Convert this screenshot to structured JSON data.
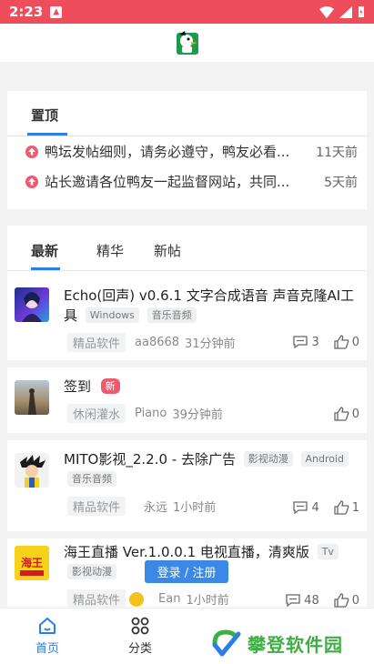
{
  "status_bar": {
    "time": "2:23"
  },
  "pinned": {
    "tab_label": "置顶",
    "items": [
      {
        "title": "鸭坛发帖细则，请务必遵守，鸭友必看...",
        "time": "11天前"
      },
      {
        "title": "站长邀请各位鸭友一起监督网站，共同...",
        "time": "5天前"
      }
    ]
  },
  "feed": {
    "tabs": [
      "最新",
      "精华",
      "新帖"
    ],
    "posts": [
      {
        "title": "Echo(回声) v0.6.1 文字合成语音 声音克隆AI工具",
        "tags": [
          "Windows",
          "音乐音频"
        ],
        "category": "精品软件",
        "author": "aa8668",
        "time": "31分钟前",
        "comments": "3",
        "likes": "0"
      },
      {
        "title": "签到",
        "badge": "新",
        "category": "休闲灌水",
        "author": "Piano",
        "time": "39分钟前",
        "likes": "0"
      },
      {
        "title": "MITO影视_2.2.0 - 去除广告",
        "tags": [
          "影视动漫",
          "Android",
          "音乐音频"
        ],
        "category": "精品软件",
        "author": "永远",
        "time": "1小时前",
        "comments": "4",
        "likes": "1"
      },
      {
        "title": "海王直播 Ver.1.0.0.1 电视直播，清爽版",
        "tags": [
          "Tv",
          "影视动漫"
        ],
        "category": "精品软件",
        "author": "Ean",
        "time": "1小时前",
        "comments": "48",
        "likes": "0"
      }
    ]
  },
  "login_button": "登录 / 注册",
  "bottom_nav": [
    {
      "label": "首页",
      "active": true
    },
    {
      "label": "分类",
      "active": false
    }
  ],
  "watermark": "攀登软件园",
  "thumb_text": "海王",
  "colors": {
    "accent": "#2b7ee5",
    "status_bar": "#ee4d5c",
    "pin": "#ef5a6e",
    "watermark": "#3fae44"
  }
}
